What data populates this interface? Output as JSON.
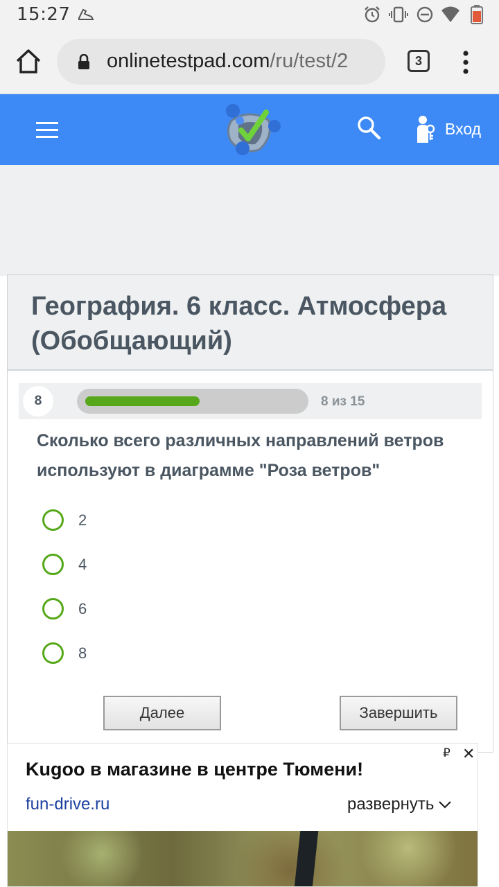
{
  "status_bar": {
    "time": "15:27"
  },
  "browser": {
    "url_domain": "onlinetestpad.com",
    "url_path": "/ru/test/2",
    "tab_count": "3"
  },
  "header": {
    "login_label": "Вход"
  },
  "test": {
    "title": "География. 6 класс. Атмосфера (Обобщающий)",
    "question_number": "8",
    "progress_text": "8 из 15",
    "progress_fraction": 0.533,
    "question": "Сколько всего различных направлений ветров используют в диаграмме \"Роза ветров\"",
    "answers": [
      "2",
      "4",
      "6",
      "8"
    ],
    "next_label": "Далее",
    "finish_label": "Завершить"
  },
  "ad": {
    "title": "Kugoo в магазине в центре Тюмени!",
    "link": "fun-drive.ru",
    "expand_label": "развернуть",
    "currency_glyph": "₽",
    "close_glyph": "✕"
  },
  "colors": {
    "header_blue": "#3d8af7",
    "accent_green": "#56a81a",
    "title_text": "#4a5661"
  }
}
